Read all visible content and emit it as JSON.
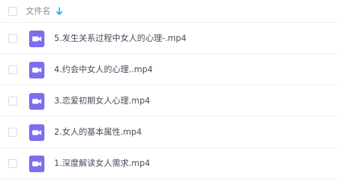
{
  "header": {
    "column_label": "文件名",
    "sort_icon": "arrow-down-icon",
    "sort_color": "#06a7ff"
  },
  "icon_color": "#7b6ff0",
  "files": [
    {
      "name": "5.发生关系过程中女人的心理-.mp4",
      "icon": "video-file-icon"
    },
    {
      "name": "4.约会中女人的心理..mp4",
      "icon": "video-file-icon"
    },
    {
      "name": "3.恋爱初期女人心理.mp4",
      "icon": "video-file-icon"
    },
    {
      "name": "2.女人的基本属性.mp4",
      "icon": "video-file-icon"
    },
    {
      "name": "1.深度解读女人需求.mp4",
      "icon": "video-file-icon"
    }
  ]
}
